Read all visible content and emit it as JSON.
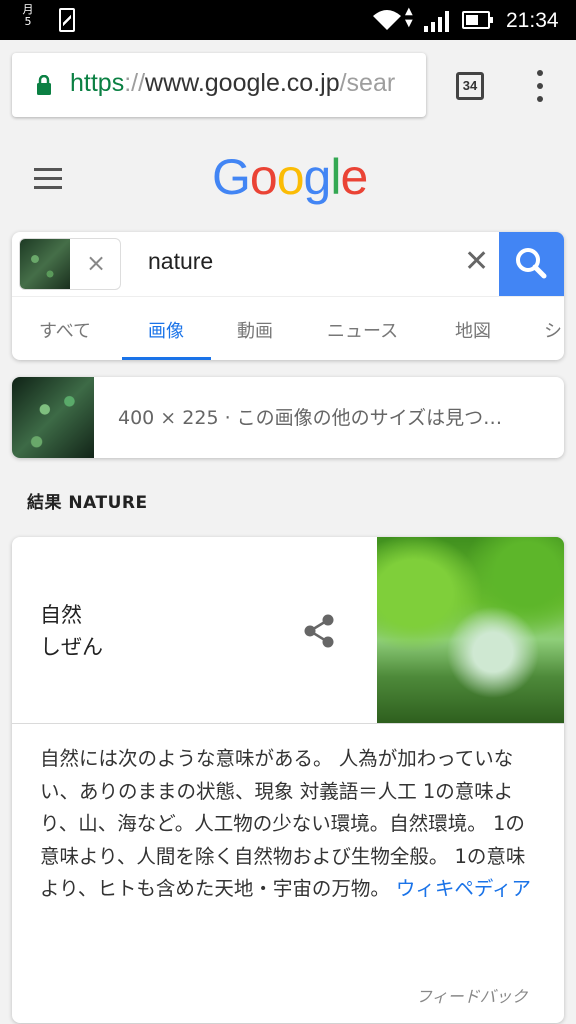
{
  "status_bar": {
    "date": "月5",
    "time": "21:34"
  },
  "browser": {
    "url_scheme": "https",
    "url_sep": "://",
    "url_host": "www.google.co.jp",
    "url_path": "/sear",
    "tab_count": "34"
  },
  "google": {
    "logo_letters": [
      {
        "ch": "G",
        "color": "#4285f4"
      },
      {
        "ch": "o",
        "color": "#ea4335"
      },
      {
        "ch": "o",
        "color": "#fbbc05"
      },
      {
        "ch": "g",
        "color": "#4285f4"
      },
      {
        "ch": "l",
        "color": "#34a853"
      },
      {
        "ch": "e",
        "color": "#ea4335"
      }
    ]
  },
  "search": {
    "chip_close": "×",
    "query": "nature",
    "clear": "✕",
    "tabs": [
      {
        "label": "すべて",
        "active": false
      },
      {
        "label": "画像",
        "active": true
      },
      {
        "label": "動画",
        "active": false
      },
      {
        "label": "ニュース",
        "active": false
      },
      {
        "label": "地図",
        "active": false
      },
      {
        "label": "シ",
        "active": false
      }
    ]
  },
  "image_info": {
    "text": "400 × 225 · この画像の他のサイズは見つ…"
  },
  "result_heading": "結果 NATURE",
  "knowledge": {
    "title": "自然",
    "reading": "しぜん",
    "description": "自然には次のような意味がある。 人為が加わっていない、ありのままの状態、現象 対義語＝人工 1の意味より、山、海など。人工物の少ない環境。自然環境。 1の意味より、人間を除く自然物および生物全般。 1の意味より、ヒトも含めた天地・宇宙の万物。",
    "source_link": "ウィキペディア",
    "feedback": "フィードバック"
  },
  "colors": {
    "accent": "#1a73e8",
    "search_button": "#4285f4",
    "lock": "#0b8043"
  }
}
